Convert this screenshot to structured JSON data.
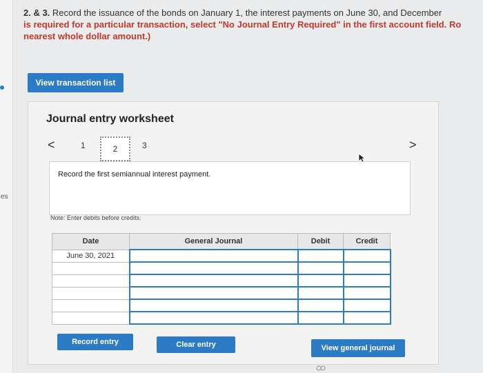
{
  "instructions": {
    "line1_lead": "2. & 3.",
    "line1_text": " Record the issuance of the bonds on January 1, the interest payments on June 30, and December",
    "line2_text": "is required for a particular transaction, select \"No Journal Entry Required\" in the first account field. Ro",
    "line3_text": "nearest whole dollar amount.)"
  },
  "margin": {
    "label": "es"
  },
  "toolbar": {
    "view_transaction_list": "View transaction list"
  },
  "worksheet": {
    "title": "Journal entry worksheet",
    "pages": [
      "1",
      "2",
      "3"
    ],
    "nav_prev": "<",
    "nav_next": ">",
    "instruction": "Record the first semiannual interest payment.",
    "note": "Note: Enter debits before credits."
  },
  "table": {
    "headers": {
      "date": "Date",
      "account": "General Journal",
      "debit": "Debit",
      "credit": "Credit"
    },
    "rows": [
      {
        "date": "June 30, 2021"
      },
      {
        "date": ""
      },
      {
        "date": ""
      },
      {
        "date": ""
      },
      {
        "date": ""
      },
      {
        "date": ""
      }
    ]
  },
  "actions": {
    "record": "Record entry",
    "clear": "Clear entry",
    "general": "View general journal"
  },
  "colors": {
    "accent": "#2d7bc4",
    "panel": "#f3f3f3",
    "background": "#eaebec"
  },
  "icons": {
    "cursor": "cursor-arrow-icon",
    "link": "link-icon"
  }
}
